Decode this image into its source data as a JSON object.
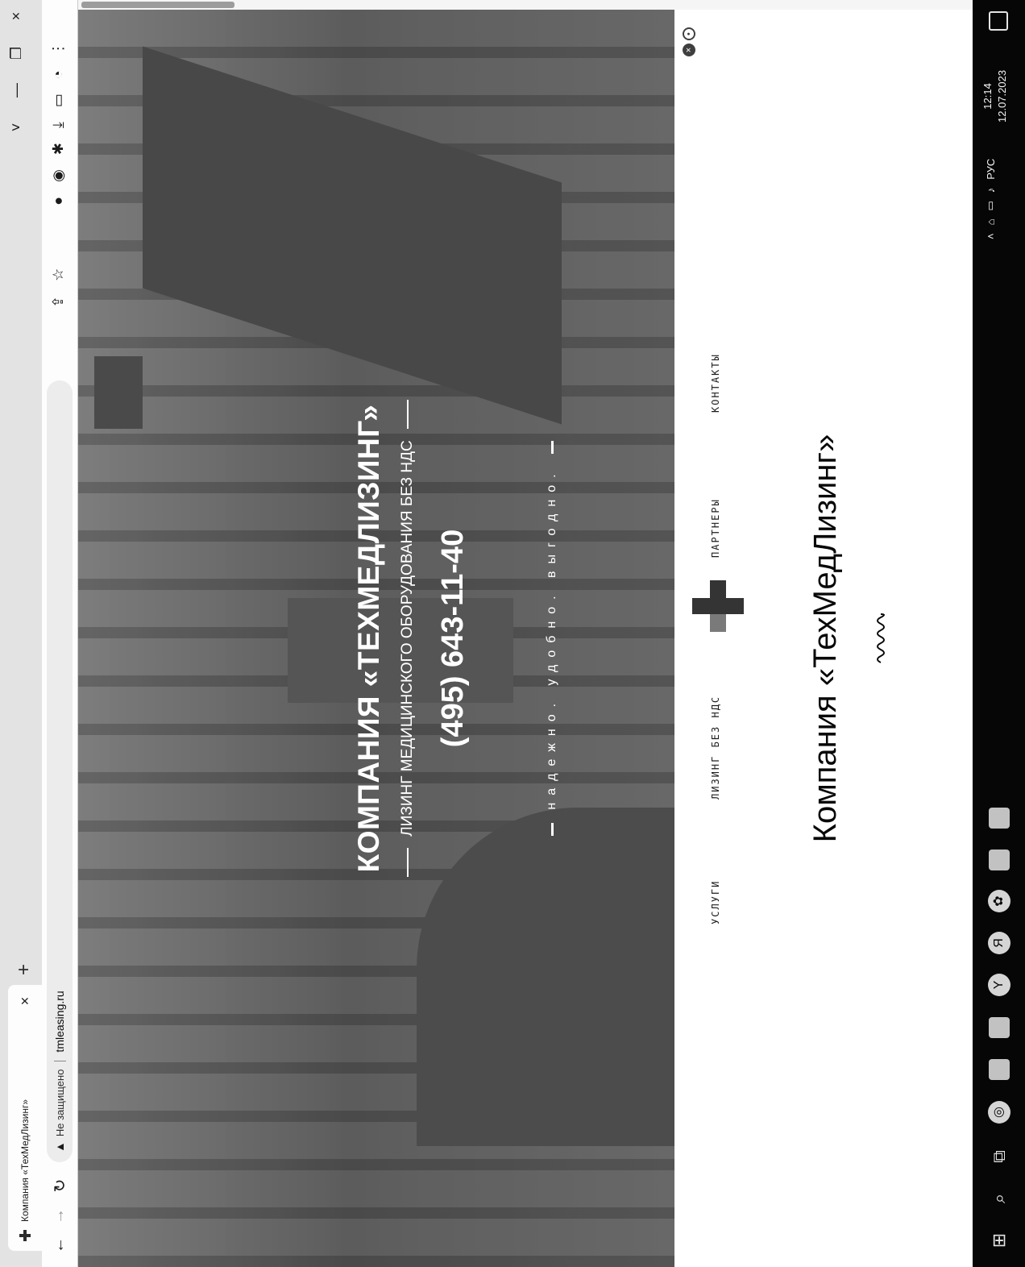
{
  "browser": {
    "tab_title": "Компания «ТехМедЛизинг»",
    "tab_close": "×",
    "new_tab": "+",
    "window_controls": [
      "˅",
      "—",
      "❐",
      "×"
    ],
    "security_label": "Не защищено",
    "url": "tmleasing.ru",
    "toolbar_icons": [
      "share-icon",
      "bookmark-star-icon",
      "extension-icon",
      "extension-icon-2",
      "puzzle-icon",
      "download-icon",
      "sidebar-icon",
      "profile-icon",
      "menu-icon"
    ]
  },
  "hero": {
    "title": "КОМПАНИЯ «ТЕХМЕДЛИЗИНГ»",
    "subtitle": "ЛИЗИНГ МЕДИЦИНСКОГО ОБОРУДОВАНИЯ БЕЗ НДС",
    "phone": "(495) 643-11-40",
    "tagline": "надежно. удобно. выгодно."
  },
  "nav": {
    "items": [
      "УСЛУГИ",
      "ЛИЗИНГ БЕЗ НДС",
      "ПАРТНЕРЫ",
      "КОНТАКТЫ"
    ]
  },
  "main": {
    "heading": "Компания «ТехМедЛизинг»"
  },
  "taskbar": {
    "apps": [
      "start-icon",
      "search-icon",
      "task-view-icon",
      "chrome-icon",
      "file-explorer-icon",
      "app-icon",
      "yandex-browser-icon",
      "yandex-icon",
      "settings-icon",
      "app-icon-2",
      "word-icon"
    ],
    "tray": {
      "language": "РУС",
      "time": "12:14",
      "date": "12.07.2023"
    }
  }
}
